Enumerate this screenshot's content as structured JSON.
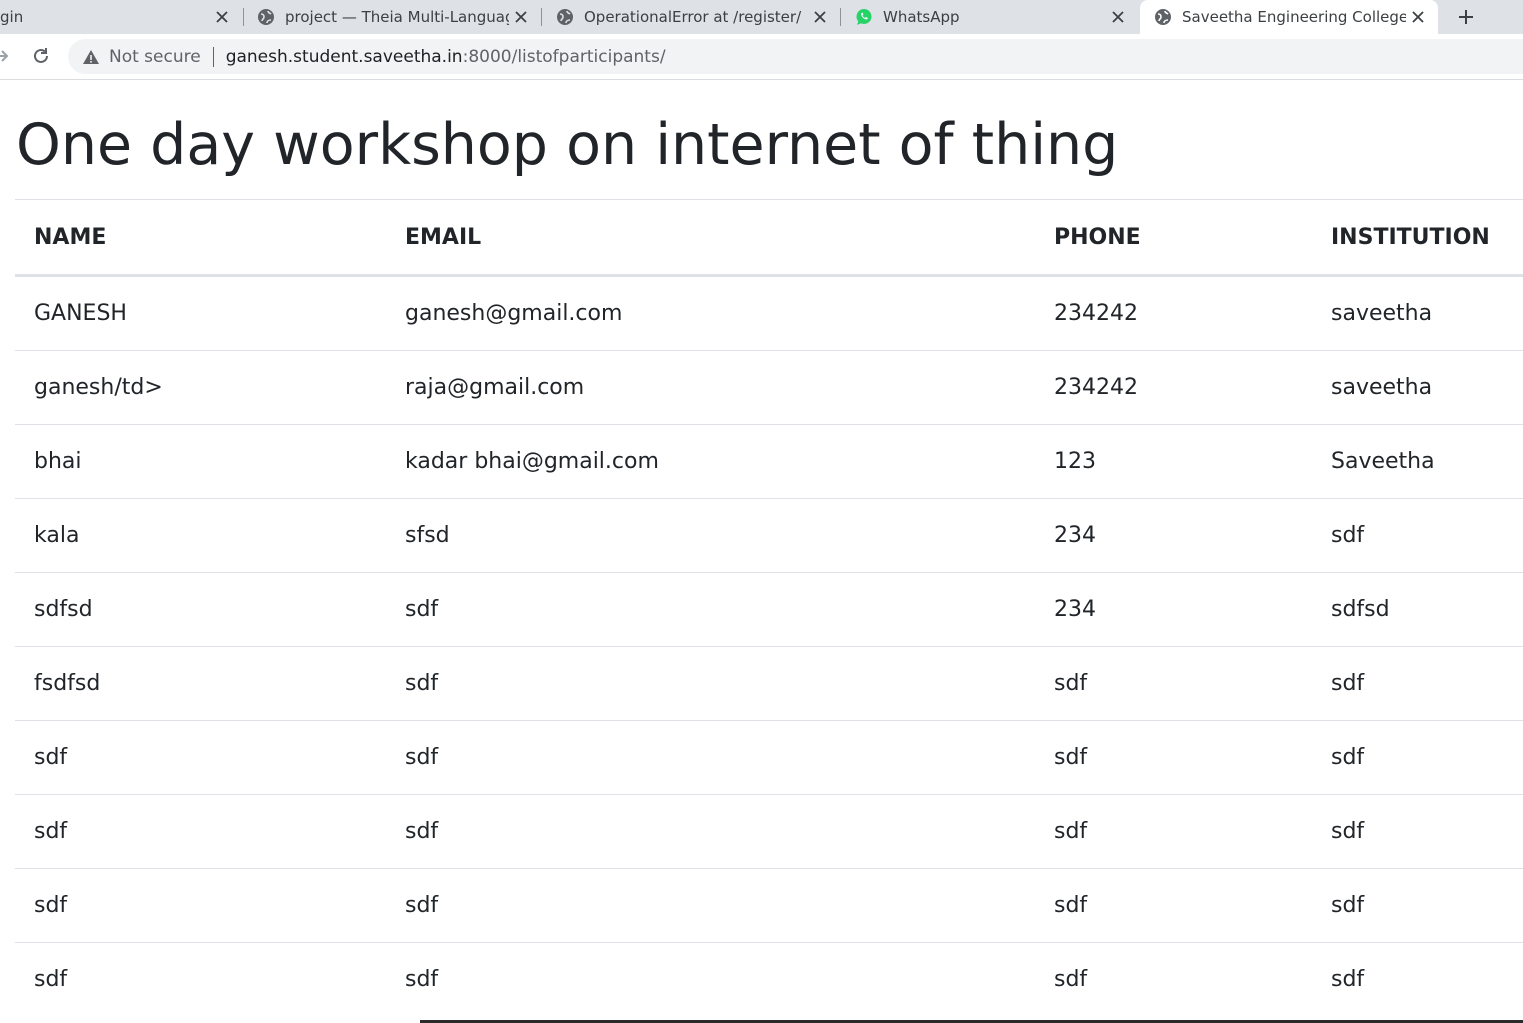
{
  "browser": {
    "tabs": [
      {
        "title": "gin",
        "icon": "none"
      },
      {
        "title": "project — Theia Multi-Language",
        "icon": "globe-icon"
      },
      {
        "title": "OperationalError at /register/",
        "icon": "globe-icon"
      },
      {
        "title": "WhatsApp",
        "icon": "whatsapp-icon"
      },
      {
        "title": "Saveetha Engineering College",
        "icon": "globe-icon",
        "active": true
      }
    ],
    "address": {
      "security_label": "Not secure",
      "host": "ganesh.student.saveetha.in",
      "path": ":8000/listofparticipants/"
    }
  },
  "page": {
    "title": "One day workshop on internet of thing",
    "table": {
      "headers": [
        "NAME",
        "EMAIL",
        "PHONE",
        "INSTITUTION"
      ],
      "rows": [
        [
          "GANESH",
          "ganesh@gmail.com",
          "234242",
          "saveetha"
        ],
        [
          "ganesh/td>",
          "raja@gmail.com",
          "234242",
          "saveetha"
        ],
        [
          "bhai",
          "kadar bhai@gmail.com",
          "123",
          "Saveetha"
        ],
        [
          "kala",
          "sfsd",
          "234",
          "sdf"
        ],
        [
          "sdfsd",
          "sdf",
          "234",
          "sdfsd"
        ],
        [
          "fsdfsd",
          "sdf",
          "sdf",
          "sdf"
        ],
        [
          "sdf",
          "sdf",
          "sdf",
          "sdf"
        ],
        [
          "sdf",
          "sdf",
          "sdf",
          "sdf"
        ],
        [
          "sdf",
          "sdf",
          "sdf",
          "sdf"
        ],
        [
          "sdf",
          "sdf",
          "sdf",
          "sdf"
        ]
      ]
    }
  },
  "colors": {
    "whatsapp": "#25d366",
    "text": "#212529",
    "border": "#dee2e6"
  }
}
